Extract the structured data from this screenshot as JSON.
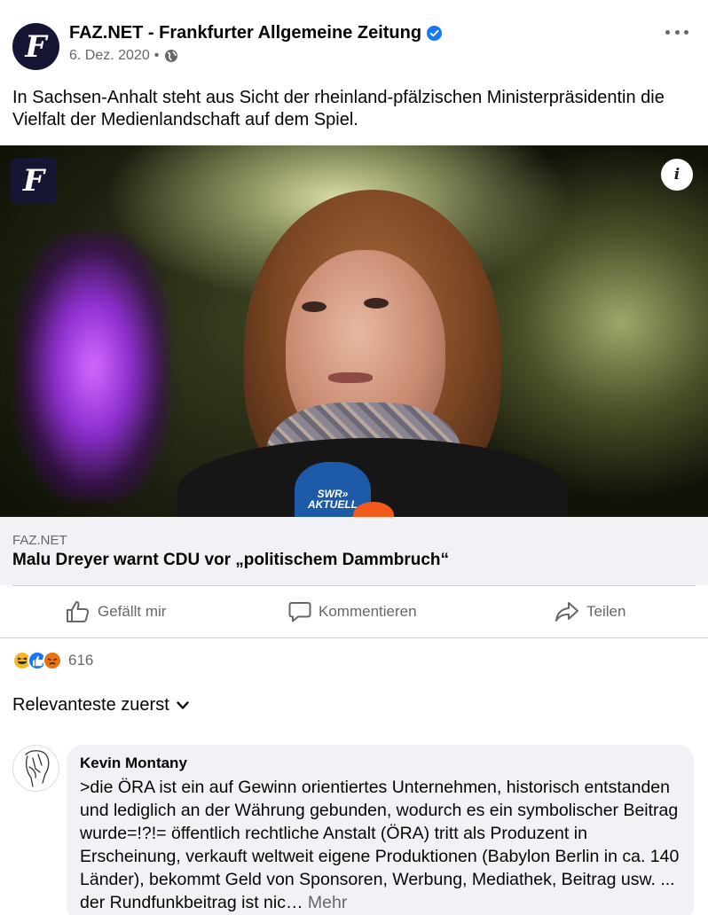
{
  "post": {
    "page_name": "FAZ.NET - Frankfurter Allgemeine Zeitung",
    "date": "6. Dez. 2020",
    "separator": "•",
    "text": "In Sachsen-Anhalt steht aus Sicht der rheinland-pfälzischen Ministerpräsidentin die Vielfalt der Medienlandschaft auf dem Spiel.",
    "avatar_glyph": "F",
    "icons": {
      "verified": "verified-badge-icon",
      "audience": "globe-icon",
      "more": "more-options-icon"
    }
  },
  "link": {
    "image_logo_glyph": "F",
    "image_mic_label": "SWR»\nAKTUELL",
    "info_glyph": "i",
    "domain": "FAZ.NET",
    "title": "Malu Dreyer warnt CDU vor „politischem Dammbruch“"
  },
  "actions": {
    "like": "Gefällt mir",
    "comment": "Kommentieren",
    "share": "Teilen"
  },
  "reactions": {
    "types": [
      "haha",
      "like",
      "angry"
    ],
    "count": "616"
  },
  "sort": {
    "label": "Relevanteste zuerst"
  },
  "comment": {
    "author": "Kevin Montany",
    "text": ">die ÖRA ist ein auf Gewinn orientiertes Unternehmen, historisch entstanden und lediglich an der Währung gebunden, wodurch es ein symbolischer Beitrag wurde=!?!= öffentlich rechtliche Anstalt (ÖRA) tritt als Produzent in Erscheinung, verkauft weltweit eigene Produktionen (Babylon Berlin in ca. 140 Länder), bekommt Geld von Sponsoren, Werbung, Mediathek, Beitrag usw. ... der Rundfunkbeitrag ist nic…",
    "more": "Mehr"
  },
  "colors": {
    "verified_blue": "#1877f2",
    "secondary_text": "#65676b",
    "bubble_bg": "#f0f2f5",
    "faz_navy": "#161634"
  }
}
